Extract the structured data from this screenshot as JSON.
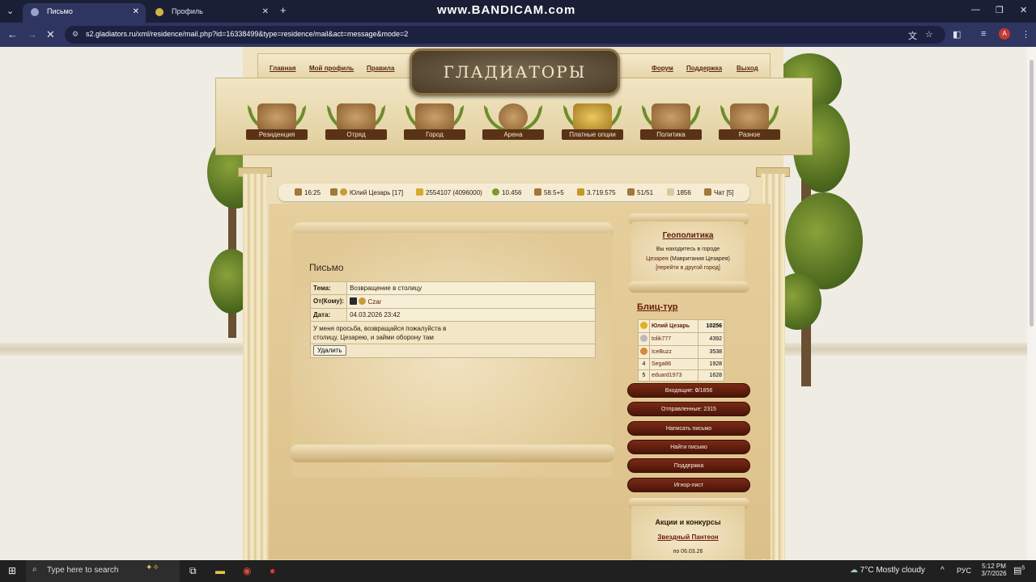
{
  "browser": {
    "tabs": [
      {
        "label": "Письмо",
        "active": true
      },
      {
        "label": "Профиль",
        "active": false
      }
    ],
    "watermark": "www.BANDICAM.com",
    "url": "s2.gladiators.ru/xml/residence/mail.php?id=16338499&type=residence/mail&act=message&mode=2",
    "avatar_letter": "A"
  },
  "site": {
    "logo": "ГЛАДИАТОРЫ",
    "topnav_left": [
      "Главная",
      "Мой профиль",
      "Правила"
    ],
    "topnav_right": [
      "Форум",
      "Поддержка",
      "Выход"
    ],
    "menu": [
      "Резиденция",
      "Отряд",
      "Город",
      "Арена",
      "Платные опции",
      "Политика",
      "Разное"
    ]
  },
  "stats": {
    "time": "16:25",
    "player": "Юлий Цезарь [17]",
    "exp": "2554107 (4096000)",
    "fame": "10.456",
    "army": "58.5+5",
    "gold": "3.719.575",
    "units": "51/51",
    "mail": "1856",
    "chat": "Чат [5]"
  },
  "letter": {
    "title": "Письмо",
    "subject_label": "Тема:",
    "subject": "Возвращение в столицу",
    "from_label": "От(Кому):",
    "from": "Czar",
    "date_label": "Дата:",
    "date": "04.03.2026 23:42",
    "body": "У меня просьба, возвращайся пожалуйста в столицу, Цезарею, и займи оборону там",
    "delete": "Удалить"
  },
  "geo": {
    "title": "Геополитика",
    "line1": "Вы находитесь в городе",
    "city": "Цезарея",
    "region": "(Мавритания Цезарея)",
    "goto": "[перейти в другой город]"
  },
  "blitz": {
    "title": "Блиц-тур",
    "rows": [
      {
        "rank": "",
        "name": "Юлий Цезарь",
        "score": "10256",
        "medal": "#e0b21e"
      },
      {
        "rank": "",
        "name": "tolik777",
        "score": "4392",
        "medal": "#b9b9b9"
      },
      {
        "rank": "",
        "name": "IceBuzz",
        "score": "3538",
        "medal": "#d58a3a"
      },
      {
        "rank": "4",
        "name": "Sega86",
        "score": "1928",
        "medal": ""
      },
      {
        "rank": "5",
        "name": "eduard1973",
        "score": "1628",
        "medal": ""
      }
    ]
  },
  "mail_menu": {
    "inbox_prefix": "Входящие: ",
    "inbox_new": "0",
    "inbox_total": "/1856",
    "sent": "Отправленные: 2315",
    "write": "Написать письмо",
    "find": "Найти письмо",
    "support": "Поддержка",
    "ignore": "Игнор-лист"
  },
  "promo": {
    "title": "Акции и конкурсы",
    "item": "Звездный Пантеон",
    "date": "по 06.03.26"
  },
  "taskbar": {
    "search": "Type here to search",
    "weather": "7°C  Mostly cloudy",
    "lang": "РУС",
    "time": "5:12 PM",
    "date": "3/7/2026",
    "notif": "5"
  }
}
